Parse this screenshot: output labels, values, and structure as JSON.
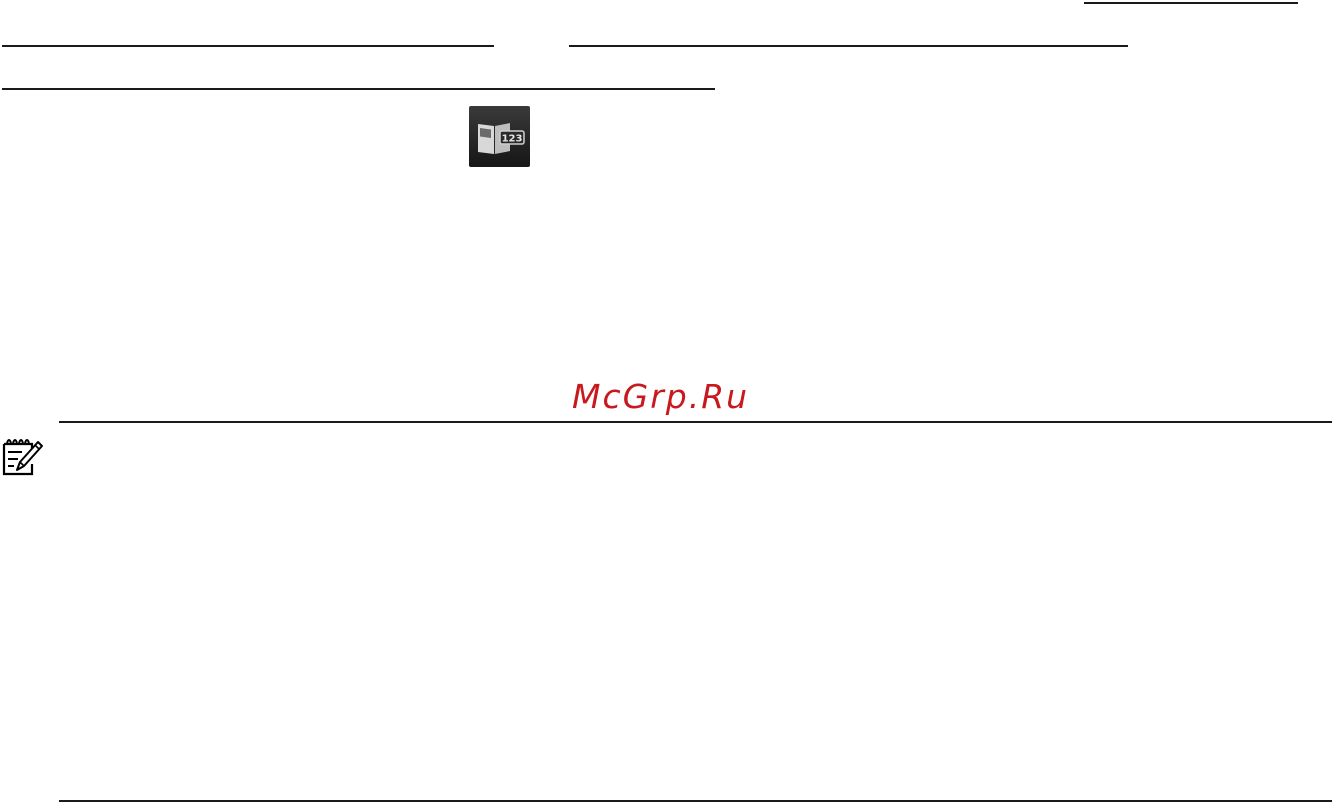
{
  "icons": {
    "page_number_icon": "book-page-number-icon",
    "note_icon": "note-pencil-icon"
  },
  "watermark": {
    "text": "McGrp.Ru",
    "color": "#c8191e"
  }
}
